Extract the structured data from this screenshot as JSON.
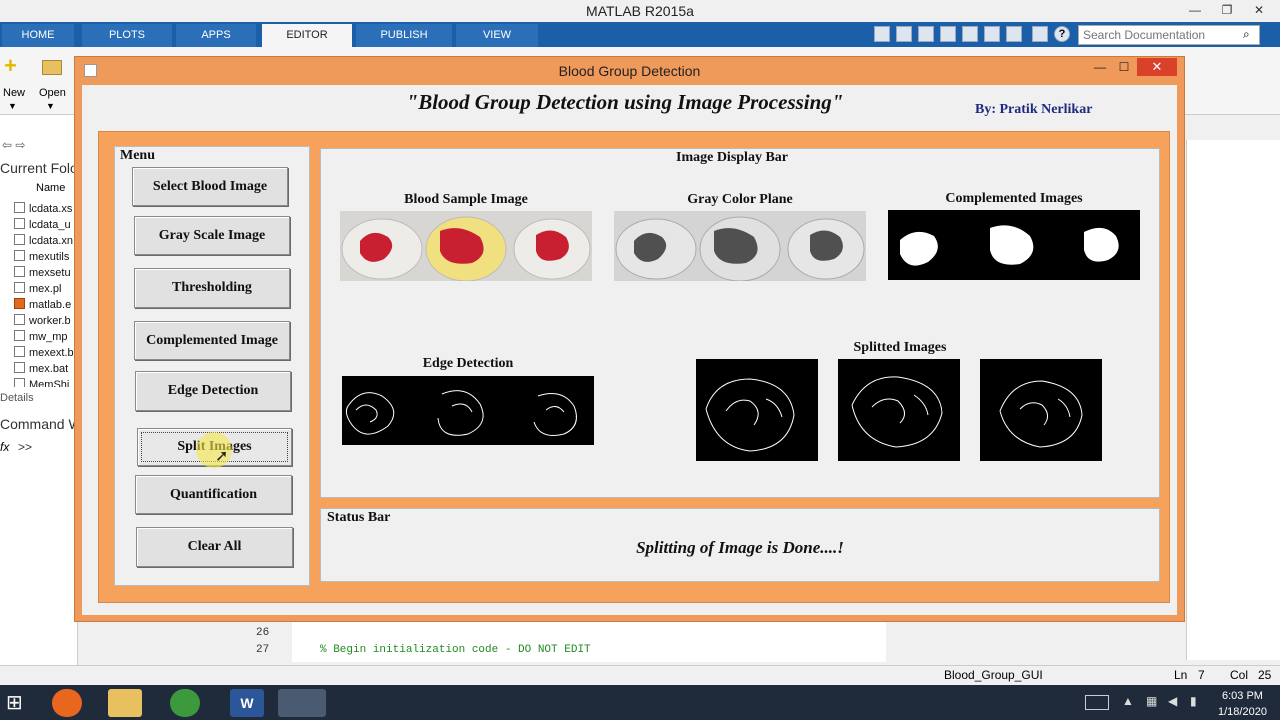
{
  "app": {
    "window_title": "MATLAB R2015a",
    "tabs": [
      "HOME",
      "PLOTS",
      "APPS",
      "EDITOR",
      "PUBLISH",
      "VIEW"
    ],
    "active_tab": "EDITOR",
    "search_placeholder": "Search Documentation",
    "toolstrip": {
      "new_label": "New",
      "open_label": "Open"
    },
    "left_panel": {
      "current_folder_label": "Current Folo",
      "name_header": "Name",
      "files": [
        "lcdata.xs",
        "lcdata_u",
        "lcdata.xn",
        "mexutils",
        "mexsetu",
        "mex.pl",
        "matlab.e",
        "worker.b",
        "mw_mp",
        "mexext.b",
        "mex.bat",
        "MemShi"
      ],
      "details_label": "Details",
      "command_window_label": "Command W",
      "prompt": ">>"
    },
    "editor": {
      "lines": [
        {
          "num": "26",
          "code": ""
        },
        {
          "num": "27",
          "code": "% Begin initialization code - DO NOT EDIT"
        }
      ]
    },
    "statusbar": {
      "file": "Blood_Group_GUI",
      "ln_label": "Ln",
      "ln": "7",
      "col_label": "Col",
      "col": "25"
    }
  },
  "gui": {
    "title": "Blood Group Detection",
    "heading": "\"Blood Group Detection using Image Processing\"",
    "author": "By: Pratik Nerlikar",
    "menu": {
      "title": "Menu",
      "buttons": [
        "Select Blood Image",
        "Gray Scale Image",
        "Thresholding",
        "Complemented Image",
        "Edge Detection",
        "Split Images",
        "Quantification",
        "Clear All"
      ]
    },
    "display": {
      "title": "Image Display Bar",
      "images": {
        "blood_sample": "Blood Sample Image",
        "gray_plane": "Gray Color Plane",
        "complemented": "Complemented Images",
        "edge": "Edge Detection",
        "splitted": "Splitted Images"
      }
    },
    "status": {
      "title": "Status Bar",
      "message": "Splitting of Image is Done....!"
    }
  },
  "taskbar": {
    "time": "6:03 PM",
    "date": "1/18/2020"
  },
  "colors": {
    "figure_frame": "#ef9a5a",
    "ribbon": "#1a5fa8",
    "close_button": "#d9412a",
    "cursor_highlight": "#f5e84a"
  }
}
